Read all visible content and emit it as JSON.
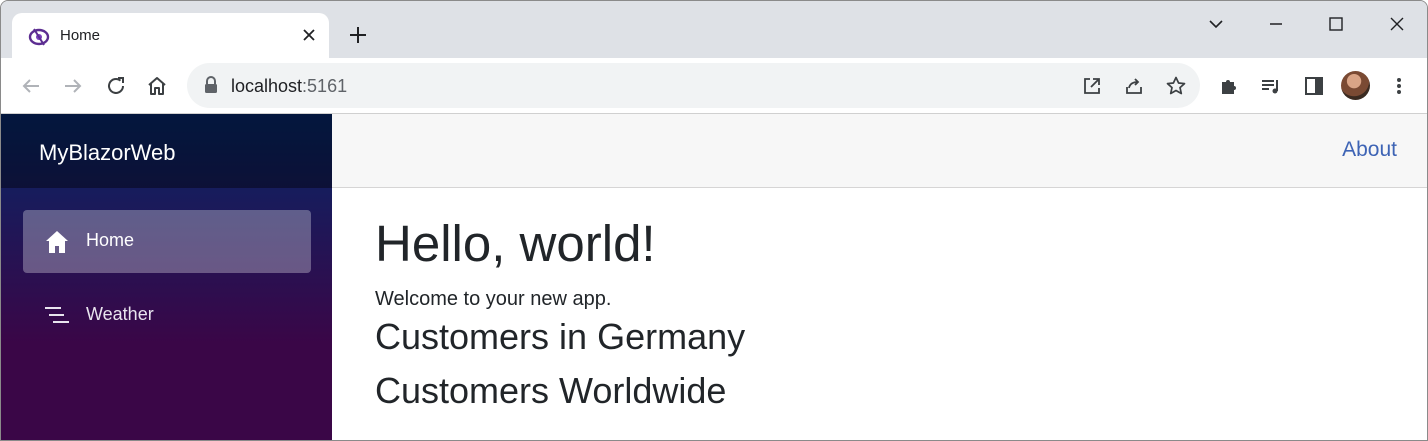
{
  "browser": {
    "tab": {
      "title": "Home",
      "favicon": "blazor-icon"
    },
    "address": {
      "host": "localhost",
      "port": ":5161"
    }
  },
  "app": {
    "brand": "MyBlazorWeb",
    "nav": [
      {
        "label": "Home",
        "icon": "house-icon",
        "active": true
      },
      {
        "label": "Weather",
        "icon": "list-lines-icon",
        "active": false
      }
    ],
    "top_link": "About",
    "heading": "Hello, world!",
    "welcome": "Welcome to your new app.",
    "sections": [
      "Customers in Germany",
      "Customers Worldwide"
    ]
  },
  "colors": {
    "link": "#3e64b5",
    "sidebar_top": "#052767",
    "sidebar_bottom": "#3a0647"
  }
}
